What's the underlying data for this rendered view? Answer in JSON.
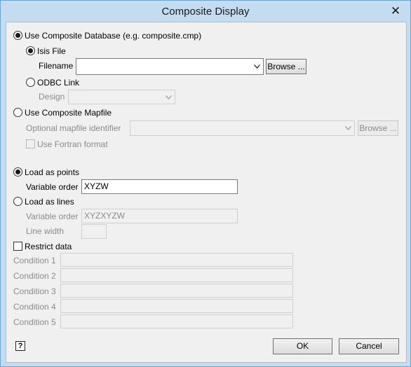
{
  "window": {
    "title": "Composite Display",
    "close_symbol": "✕"
  },
  "database": {
    "option_label": "Use Composite Database  (e.g. composite.cmp)",
    "isis_label": "Isis File",
    "filename_label": "Filename",
    "filename_value": "",
    "browse_label": "Browse ...",
    "odbc_label": "ODBC Link",
    "design_label": "Design",
    "design_value": ""
  },
  "mapfile": {
    "option_label": "Use Composite Mapfile",
    "identifier_label": "Optional mapfile identifier",
    "identifier_value": "",
    "browse_label": "Browse ...",
    "fortran_label": "Use Fortran format"
  },
  "load_points": {
    "option_label": "Load as points",
    "variable_order_label": "Variable order",
    "variable_order_value": "XYZW"
  },
  "load_lines": {
    "option_label": "Load as lines",
    "variable_order_label": "Variable order",
    "variable_order_value": "XYZXYZW",
    "line_width_label": "Line width",
    "line_width_value": ""
  },
  "restrict": {
    "label": "Restrict data",
    "conditions": [
      "Condition 1",
      "Condition 2",
      "Condition 3",
      "Condition 4",
      "Condition 5"
    ]
  },
  "footer": {
    "help_symbol": "?",
    "ok_label": "OK",
    "cancel_label": "Cancel"
  },
  "colors": {
    "frame": "#c4dcf0",
    "client": "#f0f0f0",
    "disabled_text": "#8b8b8b",
    "ok_border": "#3c7fb1"
  }
}
